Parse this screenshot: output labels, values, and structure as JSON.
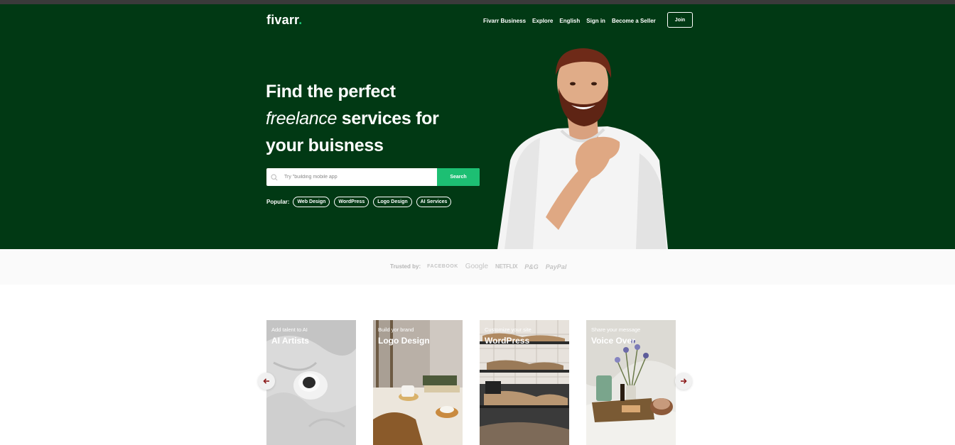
{
  "header": {
    "logo_text": "fivarr",
    "logo_dot": ".",
    "nav": [
      "Fivarr Business",
      "Explore",
      "English",
      "Sign in",
      "Become a Seller"
    ],
    "join_label": "Join"
  },
  "hero": {
    "line1": "Find the perfect",
    "line2_italic": "freelance",
    "line2_bold": " services for",
    "line3": "your buisness",
    "search_placeholder": "Try \"building mobile app",
    "search_button": "Search",
    "popular_label": "Popular:",
    "popular_tags": [
      "Web Design",
      "WordPress",
      "Logo Design",
      "AI Services"
    ]
  },
  "trusted": {
    "label": "Trusted by:",
    "brands": [
      "FACEBOOK",
      "Google",
      "NETFLIX",
      "P&G",
      "PayPal"
    ]
  },
  "services": [
    {
      "subtitle": "Add talent to AI",
      "title": "AI Artists"
    },
    {
      "subtitle": "Build yor brand",
      "title": "Logo Design"
    },
    {
      "subtitle": "Customize your site",
      "title": "WordPress"
    },
    {
      "subtitle": "Share your message",
      "title": "Voice Over"
    }
  ],
  "colors": {
    "hero_bg": "#013914",
    "accent": "#1dbf73",
    "arrow": "#8b1a1a"
  },
  "icons": {
    "search": "search-icon",
    "prev": "arrow-left-icon",
    "next": "arrow-right-icon"
  }
}
